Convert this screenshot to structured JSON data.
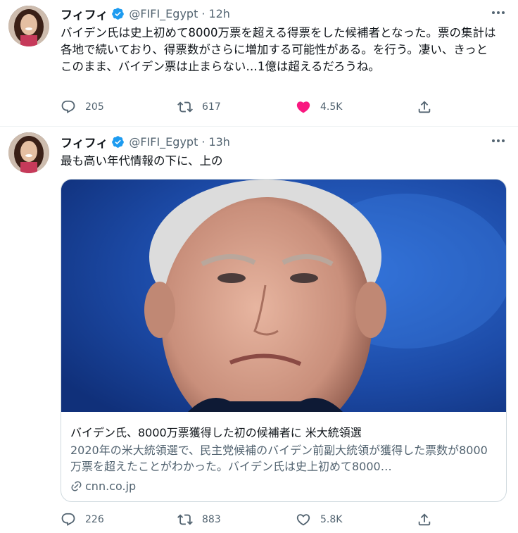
{
  "tweets": [
    {
      "author": "フィフィ",
      "handle": "@FIFI_Egypt",
      "separator": "·",
      "time": "12h",
      "text": "バイデン氏は史上初めて8000万票を超える得票をした候補者となった。票の集計は各地で続いており、得票数がさらに増加する可能性がある。を行う。凄い、きっとこのまま、バイデン票は止まらない…1億は超えるだろうね。",
      "replies": "205",
      "retweets": "617",
      "likes": "4.5K",
      "liked": true
    },
    {
      "author": "フィフィ",
      "handle": "@FIFI_Egypt",
      "separator": "·",
      "time": "13h",
      "text": "最も高い年代情報の下に、上の",
      "card": {
        "title": "バイデン氏、8000万票獲得した初の候補者に 米大統領選",
        "description": "2020年の米大統領選で、民主党候補のバイデン前副大統領が獲得した票数が8000万票を超えたことがわかった。バイデン氏は史上初めて8000…",
        "domain": "cnn.co.jp"
      },
      "replies": "226",
      "retweets": "883",
      "likes": "5.8K",
      "liked": false
    }
  ],
  "colors": {
    "like_active": "#f91880",
    "verified": "#1d9bf0",
    "secondary_text": "#536471"
  },
  "icons": [
    "verified-badge-icon",
    "more-icon",
    "reply-icon",
    "retweet-icon",
    "like-icon",
    "share-icon",
    "link-icon"
  ]
}
